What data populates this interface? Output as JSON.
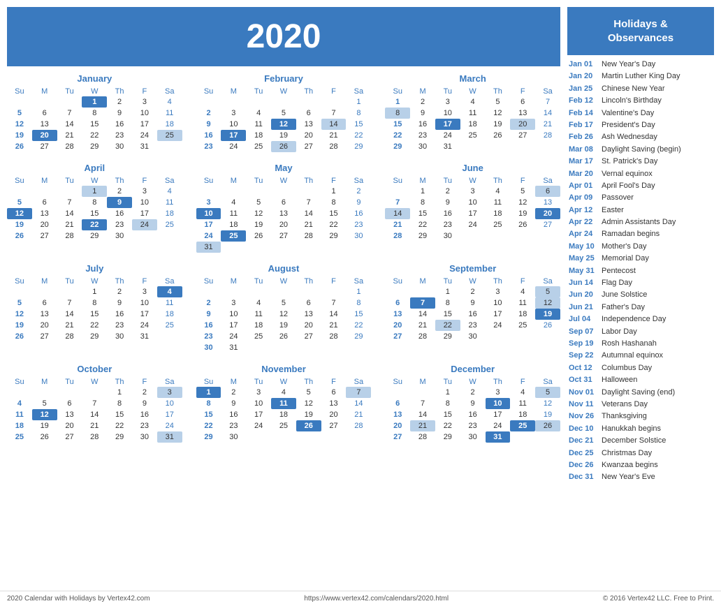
{
  "year": "2020",
  "holidays_header": "Holidays &\nObservances",
  "months": [
    {
      "name": "January",
      "days": [
        [
          null,
          null,
          null,
          1,
          2,
          3,
          4
        ],
        [
          5,
          6,
          7,
          8,
          9,
          10,
          11
        ],
        [
          12,
          13,
          14,
          15,
          16,
          17,
          18
        ],
        [
          19,
          20,
          21,
          22,
          23,
          24,
          25
        ],
        [
          26,
          27,
          28,
          29,
          30,
          31,
          null
        ]
      ],
      "highlights": {
        "1": "holiday",
        "20": "holiday",
        "25": "holiday-light"
      }
    },
    {
      "name": "February",
      "days": [
        [
          null,
          null,
          null,
          null,
          null,
          null,
          1
        ],
        [
          2,
          3,
          4,
          5,
          6,
          7,
          8
        ],
        [
          9,
          10,
          11,
          12,
          13,
          14,
          15
        ],
        [
          16,
          17,
          18,
          19,
          20,
          21,
          22
        ],
        [
          23,
          24,
          25,
          26,
          27,
          28,
          29
        ]
      ],
      "highlights": {
        "12": "holiday",
        "14": "holiday-light",
        "17": "holiday",
        "26": "holiday-light"
      }
    },
    {
      "name": "March",
      "days": [
        [
          1,
          2,
          3,
          4,
          5,
          6,
          7
        ],
        [
          8,
          9,
          10,
          11,
          12,
          13,
          14
        ],
        [
          15,
          16,
          17,
          18,
          19,
          20,
          21
        ],
        [
          22,
          23,
          24,
          25,
          26,
          27,
          28
        ],
        [
          29,
          30,
          31,
          null,
          null,
          null,
          null
        ]
      ],
      "highlights": {
        "8": "holiday-light",
        "17": "holiday",
        "20": "holiday-light"
      }
    },
    {
      "name": "April",
      "days": [
        [
          null,
          null,
          null,
          1,
          2,
          3,
          4
        ],
        [
          5,
          6,
          7,
          8,
          9,
          10,
          11
        ],
        [
          12,
          13,
          14,
          15,
          16,
          17,
          18
        ],
        [
          19,
          20,
          21,
          22,
          23,
          24,
          25
        ],
        [
          26,
          27,
          28,
          29,
          30,
          null,
          null
        ]
      ],
      "highlights": {
        "1": "holiday-light",
        "9": "holiday",
        "12": "holiday",
        "22": "holiday",
        "24": "holiday-light"
      }
    },
    {
      "name": "May",
      "days": [
        [
          null,
          null,
          null,
          null,
          null,
          1,
          2
        ],
        [
          3,
          4,
          5,
          6,
          7,
          8,
          9
        ],
        [
          10,
          11,
          12,
          13,
          14,
          15,
          16
        ],
        [
          17,
          18,
          19,
          20,
          21,
          22,
          23
        ],
        [
          24,
          25,
          26,
          27,
          28,
          29,
          30
        ],
        [
          31,
          null,
          null,
          null,
          null,
          null,
          null
        ]
      ],
      "highlights": {
        "10": "holiday",
        "25": "holiday",
        "31": "holiday-light"
      }
    },
    {
      "name": "June",
      "days": [
        [
          null,
          1,
          2,
          3,
          4,
          5,
          6
        ],
        [
          7,
          8,
          9,
          10,
          11,
          12,
          13
        ],
        [
          14,
          15,
          16,
          17,
          18,
          19,
          20
        ],
        [
          21,
          22,
          23,
          24,
          25,
          26,
          27
        ],
        [
          28,
          29,
          30,
          null,
          null,
          null,
          null
        ]
      ],
      "highlights": {
        "6": "holiday-light",
        "14": "holiday-light",
        "20": "holiday"
      }
    },
    {
      "name": "July",
      "days": [
        [
          null,
          null,
          null,
          1,
          2,
          3,
          4
        ],
        [
          5,
          6,
          7,
          8,
          9,
          10,
          11
        ],
        [
          12,
          13,
          14,
          15,
          16,
          17,
          18
        ],
        [
          19,
          20,
          21,
          22,
          23,
          24,
          25
        ],
        [
          26,
          27,
          28,
          29,
          30,
          31,
          null
        ]
      ],
      "highlights": {
        "4": "holiday"
      }
    },
    {
      "name": "August",
      "days": [
        [
          null,
          null,
          null,
          null,
          null,
          null,
          1
        ],
        [
          2,
          3,
          4,
          5,
          6,
          7,
          8
        ],
        [
          9,
          10,
          11,
          12,
          13,
          14,
          15
        ],
        [
          16,
          17,
          18,
          19,
          20,
          21,
          22
        ],
        [
          23,
          24,
          25,
          26,
          27,
          28,
          29
        ],
        [
          30,
          31,
          null,
          null,
          null,
          null,
          null
        ]
      ],
      "highlights": {}
    },
    {
      "name": "September",
      "days": [
        [
          null,
          null,
          1,
          2,
          3,
          4,
          5
        ],
        [
          6,
          7,
          8,
          9,
          10,
          11,
          12
        ],
        [
          13,
          14,
          15,
          16,
          17,
          18,
          19
        ],
        [
          20,
          21,
          22,
          23,
          24,
          25,
          26
        ],
        [
          27,
          28,
          29,
          30,
          null,
          null,
          null
        ]
      ],
      "highlights": {
        "5": "holiday-light",
        "7": "holiday",
        "12": "holiday-light",
        "19": "holiday",
        "22": "holiday-light"
      }
    },
    {
      "name": "October",
      "days": [
        [
          null,
          null,
          null,
          null,
          1,
          2,
          3
        ],
        [
          4,
          5,
          6,
          7,
          8,
          9,
          10
        ],
        [
          11,
          12,
          13,
          14,
          15,
          16,
          17
        ],
        [
          18,
          19,
          20,
          21,
          22,
          23,
          24
        ],
        [
          25,
          26,
          27,
          28,
          29,
          30,
          31
        ]
      ],
      "highlights": {
        "3": "holiday-light",
        "12": "holiday",
        "31": "holiday-light"
      }
    },
    {
      "name": "November",
      "days": [
        [
          1,
          2,
          3,
          4,
          5,
          6,
          7
        ],
        [
          8,
          9,
          10,
          11,
          12,
          13,
          14
        ],
        [
          15,
          16,
          17,
          18,
          19,
          20,
          21
        ],
        [
          22,
          23,
          24,
          25,
          26,
          27,
          28
        ],
        [
          29,
          30,
          null,
          null,
          null,
          null,
          null
        ]
      ],
      "highlights": {
        "1": "holiday",
        "7": "holiday-light",
        "11": "holiday",
        "26": "holiday"
      }
    },
    {
      "name": "December",
      "days": [
        [
          null,
          null,
          1,
          2,
          3,
          4,
          5
        ],
        [
          6,
          7,
          8,
          9,
          10,
          11,
          12
        ],
        [
          13,
          14,
          15,
          16,
          17,
          18,
          19
        ],
        [
          20,
          21,
          22,
          23,
          24,
          25,
          26
        ],
        [
          27,
          28,
          29,
          30,
          31,
          null,
          null
        ]
      ],
      "highlights": {
        "5": "holiday-light",
        "10": "holiday",
        "21": "holiday-light",
        "25": "holiday",
        "26": "holiday-light",
        "31": "holiday"
      }
    }
  ],
  "holidays": [
    {
      "date": "Jan 01",
      "name": "New Year's Day"
    },
    {
      "date": "Jan 20",
      "name": "Martin Luther King Day"
    },
    {
      "date": "Jan 25",
      "name": "Chinese New Year"
    },
    {
      "date": "Feb 12",
      "name": "Lincoln's Birthday"
    },
    {
      "date": "Feb 14",
      "name": "Valentine's Day"
    },
    {
      "date": "Feb 17",
      "name": "President's Day"
    },
    {
      "date": "Feb 26",
      "name": "Ash Wednesday"
    },
    {
      "date": "Mar 08",
      "name": "Daylight Saving (begin)"
    },
    {
      "date": "Mar 17",
      "name": "St. Patrick's Day"
    },
    {
      "date": "Mar 20",
      "name": "Vernal equinox"
    },
    {
      "date": "Apr 01",
      "name": "April Fool's Day"
    },
    {
      "date": "Apr 09",
      "name": "Passover"
    },
    {
      "date": "Apr 12",
      "name": "Easter"
    },
    {
      "date": "Apr 22",
      "name": "Admin Assistants Day"
    },
    {
      "date": "Apr 24",
      "name": "Ramadan begins"
    },
    {
      "date": "May 10",
      "name": "Mother's Day"
    },
    {
      "date": "May 25",
      "name": "Memorial Day"
    },
    {
      "date": "May 31",
      "name": "Pentecost"
    },
    {
      "date": "Jun 14",
      "name": "Flag Day"
    },
    {
      "date": "Jun 20",
      "name": "June Solstice"
    },
    {
      "date": "Jun 21",
      "name": "Father's Day"
    },
    {
      "date": "Jul 04",
      "name": "Independence Day"
    },
    {
      "date": "Sep 07",
      "name": "Labor Day"
    },
    {
      "date": "Sep 19",
      "name": "Rosh Hashanah"
    },
    {
      "date": "Sep 22",
      "name": "Autumnal equinox"
    },
    {
      "date": "Oct 12",
      "name": "Columbus Day"
    },
    {
      "date": "Oct 31",
      "name": "Halloween"
    },
    {
      "date": "Nov 01",
      "name": "Daylight Saving (end)"
    },
    {
      "date": "Nov 11",
      "name": "Veterans Day"
    },
    {
      "date": "Nov 26",
      "name": "Thanksgiving"
    },
    {
      "date": "Dec 10",
      "name": "Hanukkah begins"
    },
    {
      "date": "Dec 21",
      "name": "December Solstice"
    },
    {
      "date": "Dec 25",
      "name": "Christmas Day"
    },
    {
      "date": "Dec 26",
      "name": "Kwanzaa begins"
    },
    {
      "date": "Dec 31",
      "name": "New Year's Eve"
    }
  ],
  "footer": {
    "left": "2020 Calendar with Holidays by Vertex42.com",
    "center": "https://www.vertex42.com/calendars/2020.html",
    "right": "© 2016 Vertex42 LLC. Free to Print."
  },
  "weekdays": [
    "Su",
    "M",
    "Tu",
    "W",
    "Th",
    "F",
    "Sa"
  ]
}
